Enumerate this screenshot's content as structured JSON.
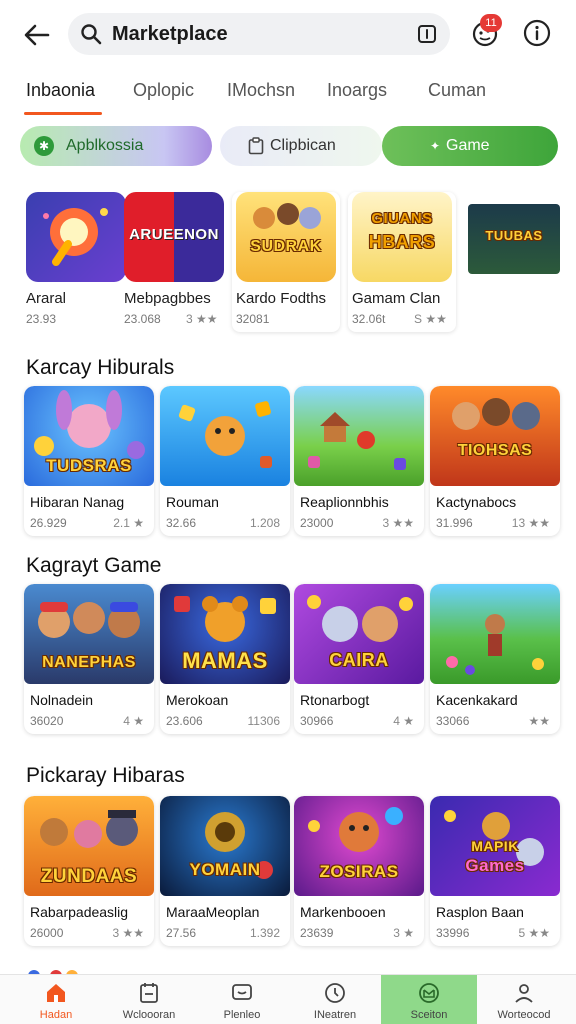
{
  "header": {
    "search_text": "Marketplace",
    "notification_count": "11"
  },
  "tabs": [
    "Inbaonia",
    "Oplopic",
    "IMochsn",
    "Inoargs",
    "Cuman"
  ],
  "chips": {
    "chip1": "Apblkossia",
    "chip2": "Clipbican",
    "chip3": "Game"
  },
  "top_apps": [
    {
      "name": "Araral",
      "downloads": "23.93",
      "rating": ""
    },
    {
      "name": "Mebpagbbes",
      "downloads": "23.068",
      "rating": "3"
    },
    {
      "name": "Kardo Fodths",
      "downloads": "32081",
      "rating": ""
    },
    {
      "name": "Gamam Clan",
      "downloads": "32.06t",
      "rating": "S"
    },
    {
      "name": "",
      "downloads": "",
      "rating": ""
    }
  ],
  "sections": [
    {
      "title": "Karcay Hiburals",
      "items": [
        {
          "name": "Hibaran Nanag",
          "downloads": "26.929",
          "rating": "2.1",
          "art": "TUDSRAS"
        },
        {
          "name": "Rouman",
          "downloads": "32.66",
          "rating": "1.208",
          "art": ""
        },
        {
          "name": "Reaplionnbhis",
          "downloads": "23000",
          "rating": "3",
          "art": ""
        },
        {
          "name": "Kactynabocs",
          "downloads": "31.996",
          "rating": "13",
          "art": "TIOHSAS"
        }
      ]
    },
    {
      "title": "Kagrayt Game",
      "items": [
        {
          "name": "Nolnadein",
          "downloads": "36020",
          "rating": "4",
          "art": "NANEPHAS"
        },
        {
          "name": "Merokoan",
          "downloads": "23.606",
          "rating": "11306",
          "art": "MAMAS"
        },
        {
          "name": "Rtonarbogt",
          "downloads": "30966",
          "rating": "4",
          "art": "CAIRA"
        },
        {
          "name": "Kacenkakard",
          "downloads": "33066",
          "rating": "",
          "art": ""
        }
      ]
    },
    {
      "title": "Pickaray Hibaras",
      "items": [
        {
          "name": "Rabarpadeaslig",
          "downloads": "26000",
          "rating": "3",
          "art": "ZUNDAAS"
        },
        {
          "name": "MaraaMeoplan",
          "downloads": "27.56",
          "rating": "1.392",
          "art": "YOMAIN"
        },
        {
          "name": "Markenbooen",
          "downloads": "23639",
          "rating": "3",
          "art": "ZOSIRAS"
        },
        {
          "name": "Rasplon Baan",
          "downloads": "33996",
          "rating": "5",
          "art": "Games"
        }
      ]
    }
  ],
  "bottom_nav": [
    "Hadan",
    "Wcloooran",
    "Plenleo",
    "INeatren",
    "Sceiton",
    "Worteocod"
  ],
  "colors": {
    "accent": "#f2571f",
    "green": "#3ea53a",
    "badge": "#e53935"
  }
}
